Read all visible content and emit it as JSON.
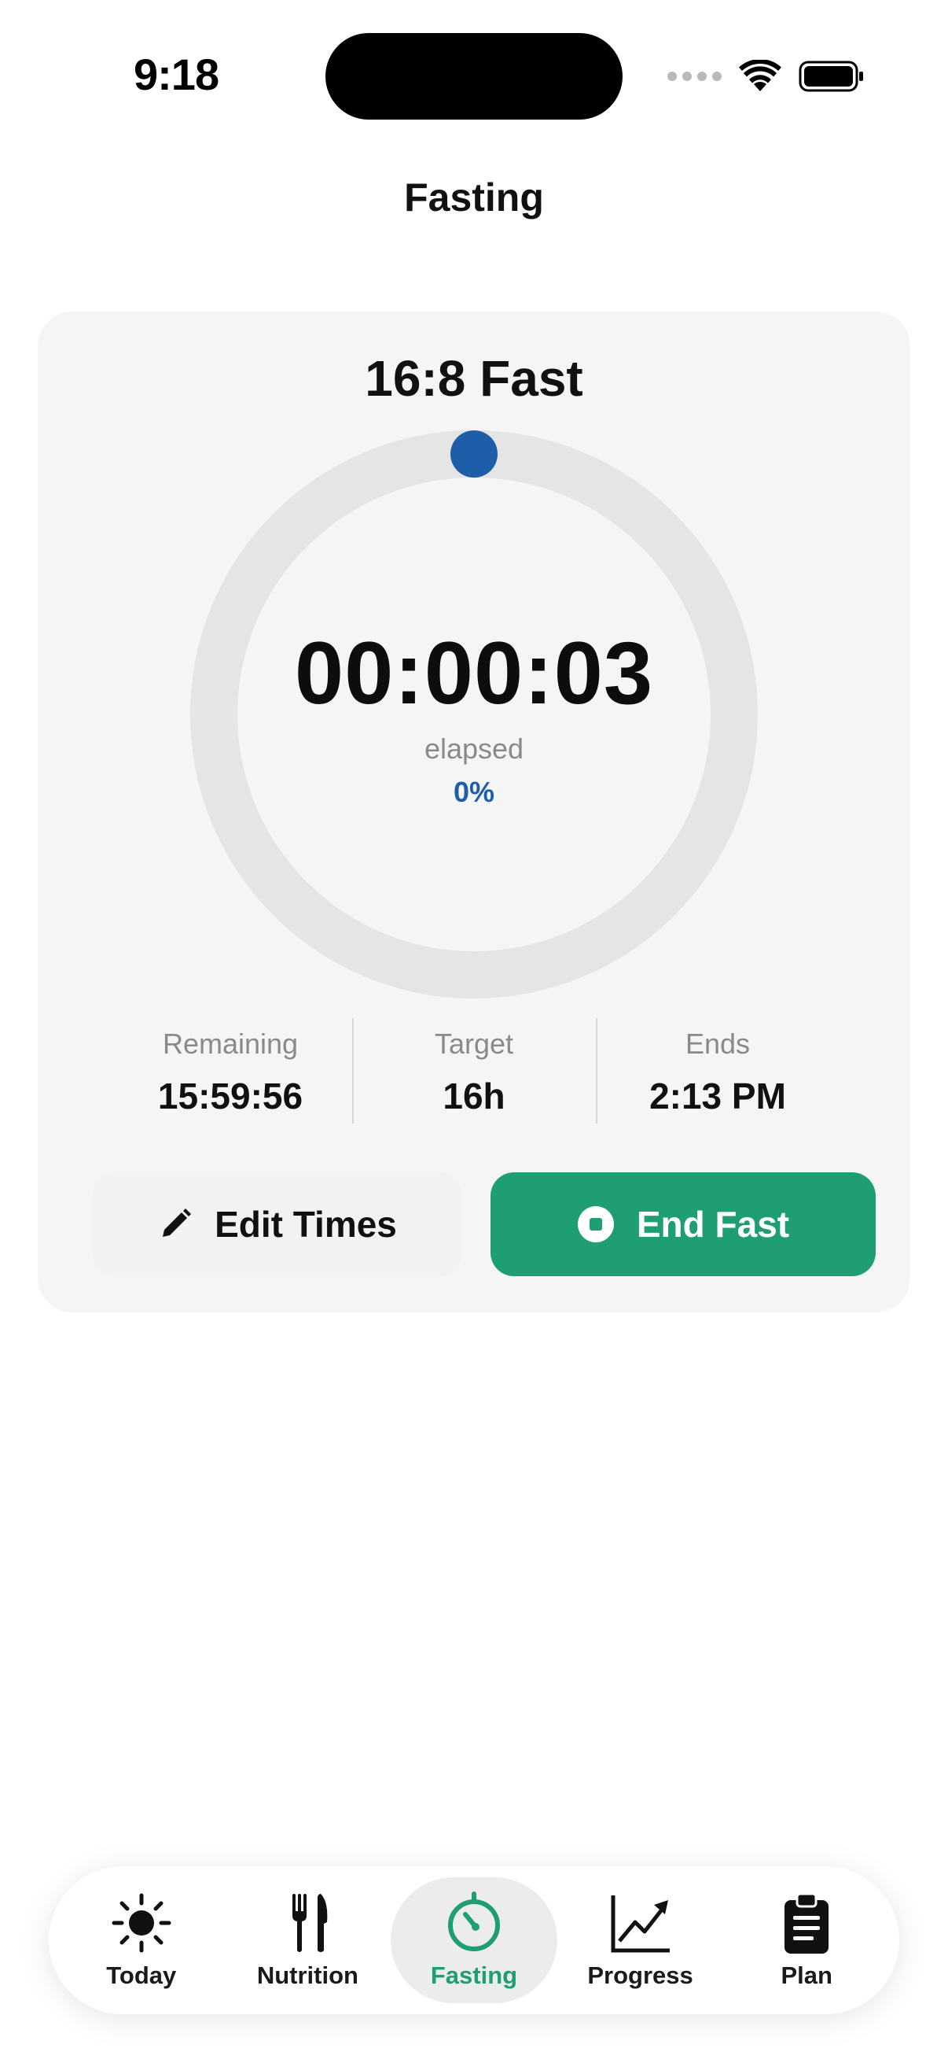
{
  "status_bar": {
    "time": "9:18"
  },
  "page_title": "Fasting",
  "fast_card": {
    "name": "16:8 Fast",
    "timer": "00:00:03",
    "elapsed_label": "elapsed",
    "percent_text": "0%",
    "progress_fraction": 0.0,
    "stats": [
      {
        "label": "Remaining",
        "value": "15:59:56"
      },
      {
        "label": "Target",
        "value": "16h"
      },
      {
        "label": "Ends",
        "value": "2:13 PM"
      }
    ],
    "edit_label": "Edit Times",
    "end_label": "End Fast"
  },
  "colors": {
    "accent_green": "#1f9e73",
    "progress_blue": "#1e5ea8",
    "ring_track": "#e4e5e4"
  },
  "tabs": [
    {
      "label": "Today",
      "icon": "sun-icon",
      "active": false
    },
    {
      "label": "Nutrition",
      "icon": "fork-knife-icon",
      "active": false
    },
    {
      "label": "Fasting",
      "icon": "timer-icon",
      "active": true
    },
    {
      "label": "Progress",
      "icon": "chart-line-icon",
      "active": false
    },
    {
      "label": "Plan",
      "icon": "clipboard-icon",
      "active": false
    }
  ]
}
